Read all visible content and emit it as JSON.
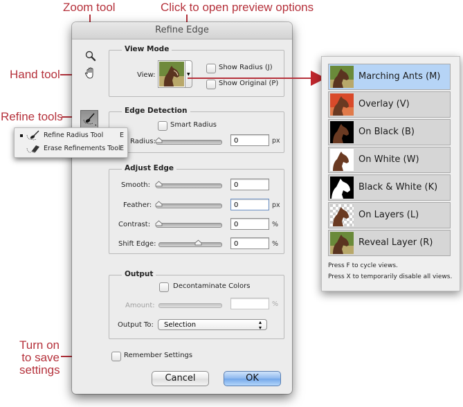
{
  "callouts": {
    "zoom_tool": "Zoom tool",
    "preview_options": "Click to open preview options",
    "hand_tool": "Hand tool",
    "refine_tools": "Refine tools",
    "remember_line1": "Turn on",
    "remember_line2": "to save",
    "remember_line3": "settings"
  },
  "dialog": {
    "title": "Refine Edge",
    "tools": [
      "zoom-icon",
      "hand-icon",
      "refine-radius-icon"
    ],
    "view_mode": {
      "title": "View Mode",
      "view_label": "View:",
      "show_radius": {
        "label": "Show Radius (J)",
        "checked": false
      },
      "show_original": {
        "label": "Show Original (P)",
        "checked": false
      }
    },
    "edge_detection": {
      "title": "Edge Detection",
      "smart_radius": {
        "label": "Smart Radius",
        "checked": false
      },
      "radius": {
        "label": "Radius:",
        "value": "0",
        "unit": "px",
        "slider": 0
      }
    },
    "adjust_edge": {
      "title": "Adjust Edge",
      "smooth": {
        "label": "Smooth:",
        "value": "0",
        "unit": "",
        "slider": 0
      },
      "feather": {
        "label": "Feather:",
        "value": "0",
        "unit": "px",
        "slider": 0
      },
      "contrast": {
        "label": "Contrast:",
        "value": "0",
        "unit": "%",
        "slider": 0
      },
      "shift_edge": {
        "label": "Shift Edge:",
        "value": "0",
        "unit": "%",
        "slider": 0.5
      }
    },
    "output": {
      "title": "Output",
      "decontaminate": {
        "label": "Decontaminate Colors",
        "checked": false
      },
      "amount": {
        "label": "Amount:",
        "value": "",
        "unit": "%"
      },
      "output_to": {
        "label": "Output To:",
        "value": "Selection"
      }
    },
    "remember": {
      "label": "Remember Settings",
      "checked": false
    },
    "buttons": {
      "cancel": "Cancel",
      "ok": "OK"
    }
  },
  "flyout": {
    "items": [
      {
        "label": "Refine Radius Tool",
        "key": "E",
        "active": true
      },
      {
        "label": "Erase Refinements Tool",
        "key": "E",
        "active": false
      }
    ]
  },
  "view_popup": {
    "items": [
      {
        "label": "Marching Ants (M)",
        "selected": true
      },
      {
        "label": "Overlay (V)",
        "selected": false
      },
      {
        "label": "On Black (B)",
        "selected": false
      },
      {
        "label": "On White (W)",
        "selected": false
      },
      {
        "label": "Black & White (K)",
        "selected": false
      },
      {
        "label": "On Layers (L)",
        "selected": false
      },
      {
        "label": "Reveal Layer (R)",
        "selected": false
      }
    ],
    "notes": [
      "Press F to cycle views.",
      "Press X to temporarily disable all views."
    ]
  },
  "colors": {
    "callout": "#b5313b",
    "selected": "#b6d4f6",
    "ok_button": "#73a7e9"
  }
}
